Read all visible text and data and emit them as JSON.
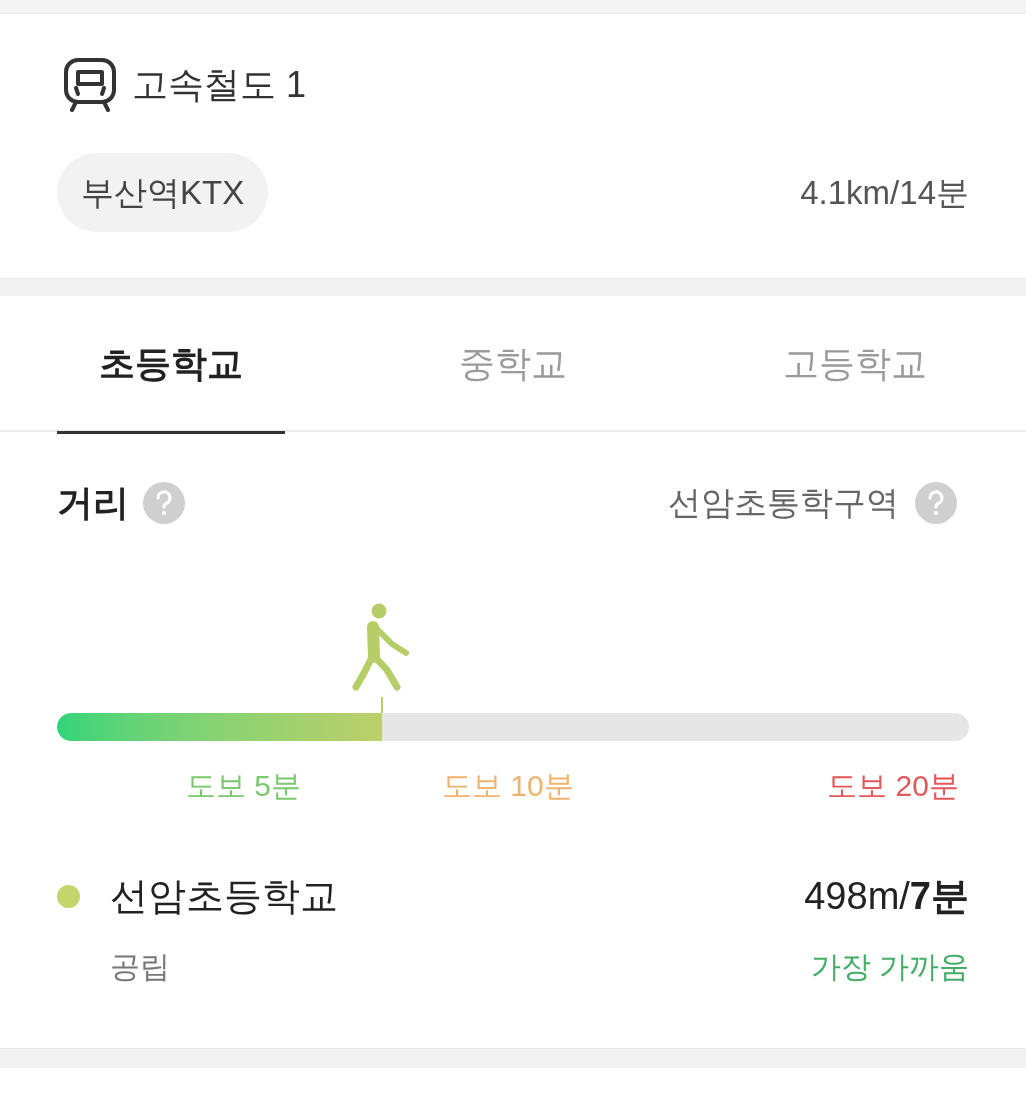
{
  "transit": {
    "kind": "train",
    "title": "고속철도 1",
    "station": "부산역KTX",
    "distance": "4.1km/14분"
  },
  "tabs": [
    {
      "label": "초등학교",
      "selected": true
    },
    {
      "label": "중학교",
      "selected": false
    },
    {
      "label": "고등학교",
      "selected": false
    }
  ],
  "distance": {
    "title": "거리",
    "zone": "선암초통학구역",
    "level": 0.356,
    "scale": [
      {
        "label": "도보 5분",
        "color": "#7cc86e"
      },
      {
        "label": "도보 10분",
        "color": "#f0b36e"
      },
      {
        "label": "도보 20분",
        "color": "#e2585b"
      }
    ]
  },
  "schools": [
    {
      "name": "선암초등학교",
      "color": "#c3d66c",
      "type": "공립",
      "distance": "498m/**7분**",
      "note": "가장 가까움"
    }
  ]
}
